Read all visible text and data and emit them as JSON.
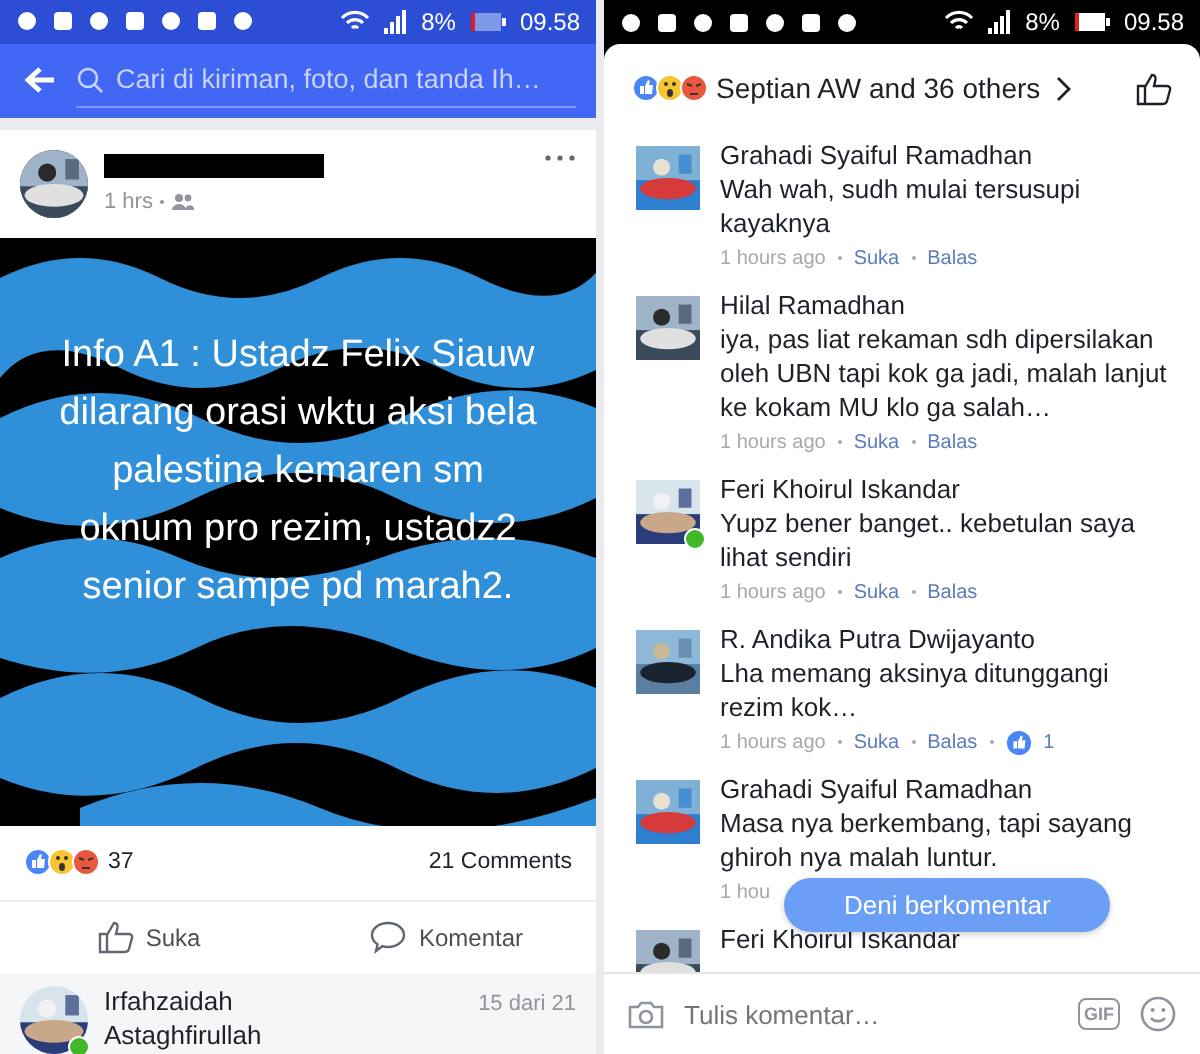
{
  "left": {
    "status_bar": {
      "battery": "8%",
      "time": "09.58"
    },
    "search": {
      "placeholder": "Cari di kiriman, foto, dan tanda Ih…"
    },
    "post": {
      "time": "1 hrs",
      "image_text": "Info A1 : Ustadz Felix Siauw dilarang orasi wktu aksi bela palestina kemaren sm oknum pro rezim, ustadz2 senior sampe pd marah2.",
      "reaction_count": "37",
      "comment_count": "21 Comments",
      "actions": [
        {
          "kind": "like",
          "label": "Suka"
        },
        {
          "kind": "comment",
          "label": "Komentar"
        }
      ],
      "comment_preview": {
        "name": "Irfahzaidah",
        "position": "15 dari 21",
        "text": "Astaghfirullah",
        "online": true
      }
    }
  },
  "right": {
    "status_bar": {
      "battery": "8%",
      "time": "09.58"
    },
    "reactions_summary": "Septian AW and 36 others",
    "comments": [
      {
        "name": "Grahadi Syaiful Ramadhan",
        "text": "Wah wah, sudh mulai tersusupi kayaknya",
        "time": "1 hours ago",
        "like": "Suka",
        "reply": "Balas",
        "online": false
      },
      {
        "name": "Hilal Ramadhan",
        "text": "iya, pas liat rekaman sdh dipersilakan oleh UBN tapi kok ga jadi, malah lanjut ke kokam MU klo ga salah…",
        "time": "1 hours ago",
        "like": "Suka",
        "reply": "Balas",
        "online": false
      },
      {
        "name": "Feri Khoirul Iskandar",
        "text": "Yupz bener banget.. kebetulan saya lihat sendiri",
        "time": "1 hours ago",
        "like": "Suka",
        "reply": "Balas",
        "online": true
      },
      {
        "name": "R. Andika Putra Dwijayanto",
        "text": "Lha memang aksinya ditunggangi rezim kok…",
        "time": "1 hours ago",
        "like": "Suka",
        "reply": "Balas",
        "likes": "1",
        "online": false
      },
      {
        "name": "Grahadi Syaiful Ramadhan",
        "text": "Masa nya berkembang, tapi sayang ghiroh nya malah luntur.",
        "time": "1 hou",
        "online": false
      },
      {
        "name": "Feri Khoirul Iskandar",
        "online": false
      }
    ],
    "toast": "Deni berkomentar",
    "input": {
      "placeholder": "Tulis komentar…",
      "gif": "GIF"
    }
  }
}
